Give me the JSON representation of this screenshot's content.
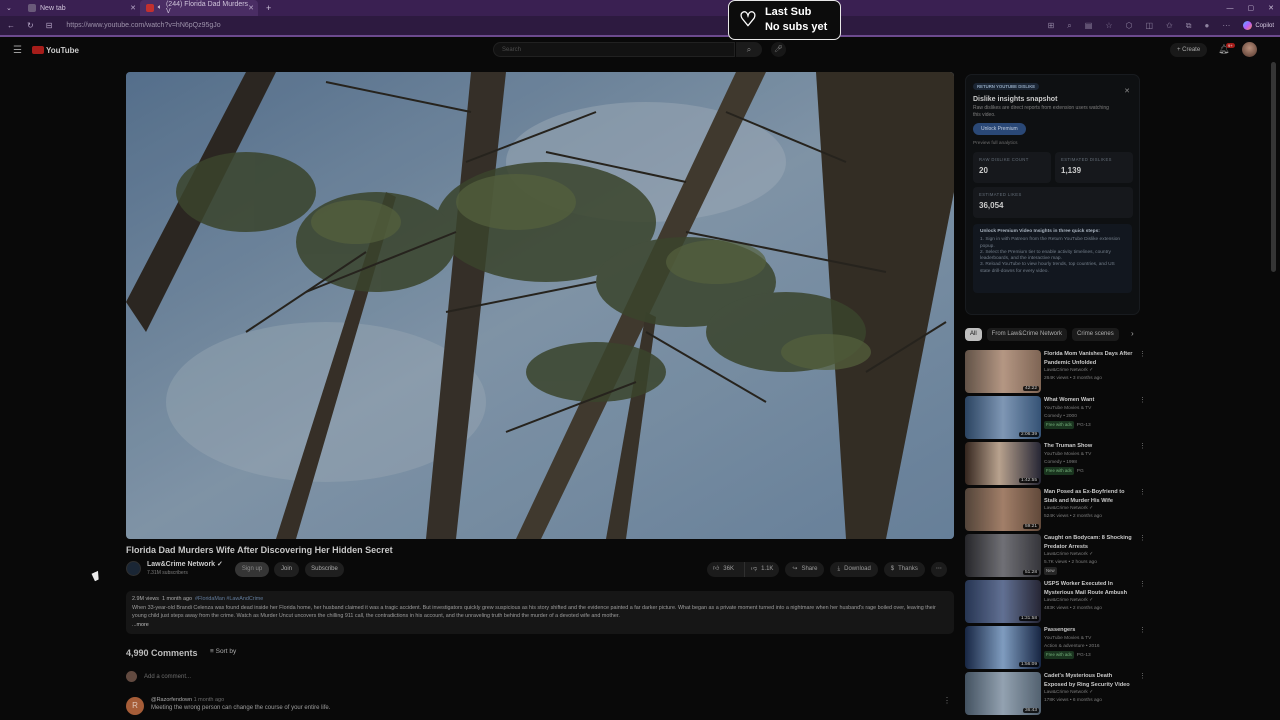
{
  "browser": {
    "tabs": [
      {
        "title": "New tab"
      },
      {
        "title": "(244) Florida Dad Murders V"
      }
    ],
    "url": "https://www.youtube.com/watch?v=hN6pQz95gJo",
    "copilot_label": "Copilot",
    "window_controls": {
      "min": "—",
      "max": "▢",
      "close": "✕"
    }
  },
  "overlay": {
    "last_sub_title": "Last Sub",
    "last_sub_value": "No subs yet"
  },
  "youtube_header": {
    "logo": "YouTube",
    "search_placeholder": "Search",
    "create_label": "Create",
    "notifications_badge": "9+"
  },
  "video": {
    "title": "Florida Dad Murders Wife After Discovering Her Hidden Secret",
    "channel": "Law&Crime Network",
    "subscribers": "7.31M subscribers",
    "signup_label": "Sign up",
    "join_label": "Join",
    "subscribe_label": "Subscribe",
    "likes": "36K",
    "dislikes": "1.1K",
    "share_label": "Share",
    "download_label": "Download",
    "thanks_label": "Thanks"
  },
  "description": {
    "views": "2.9M views",
    "age": "1 month ago",
    "tags": "#FloridaMan #LawAndCrime",
    "body": "When 33-year-old Brandi Celenza was found dead inside her Florida home, her husband claimed it was a tragic accident. But investigators quickly grew suspicious as his story shifted and the evidence painted a far darker picture. What began as a private moment turned into a nightmare when her husband's rage boiled over, leaving their young child just steps away from the crime. Watch as Murder Uncut uncovers the chilling 911 call, the contradictions in his account, and the unraveling truth behind the murder of a devoted wife and mother.",
    "more": "...more"
  },
  "comments": {
    "count": "4,990 Comments",
    "sort_label": "Sort by",
    "add_placeholder": "Add a comment...",
    "items": [
      {
        "initial": "R",
        "author": "@Razorfendown",
        "age": "1 month ago",
        "text": "Meeting the wrong person can change the course of your entire life."
      }
    ]
  },
  "dislike_panel": {
    "badge": "RETURN YOUTUBE DISLIKE",
    "title": "Dislike insights snapshot",
    "subtitle": "Raw dislikes are direct reports from extension users watching this video.",
    "unlock_label": "Unlock Premium",
    "preview_label": "Preview full analytics",
    "stats": [
      {
        "label": "RAW DISLIKE COUNT",
        "value": "20"
      },
      {
        "label": "ESTIMATED DISLIKES",
        "value": "1,139"
      },
      {
        "label": "ESTIMATED LIKES",
        "value": "36,054"
      }
    ],
    "steps_title": "Unlock Premium Video Insights in three quick steps:",
    "steps": [
      "1. Sign in with Patreon from the Return YouTube Dislike extension popup.",
      "2. Select the Premium tier to enable activity timelines, country leaderboards, and the interactive map.",
      "3. Reload YouTube to view hourly trends, top countries, and US state drill-downs for every video."
    ]
  },
  "chips": [
    "All",
    "From Law&Crime Network",
    "Crime scenes"
  ],
  "recommendations": [
    {
      "title": "Florida Mom Vanishes Days After Pandemic Unfolded",
      "channel": "Law&Crime Network",
      "meta": "264K views • 3 months ago",
      "duration": "42:22",
      "tag": ""
    },
    {
      "title": "What Women Want",
      "channel": "YouTube Movies & TV",
      "meta": "Comedy • 2000",
      "duration": "2:06:39",
      "tag": "Free with ads",
      "rating": "PG-13"
    },
    {
      "title": "The Truman Show",
      "channel": "YouTube Movies & TV",
      "meta": "Comedy • 1998",
      "duration": "1:42:55",
      "tag": "Free with ads",
      "rating": "PG"
    },
    {
      "title": "Man Posed as Ex-Boyfriend to Stalk and Murder His Wife",
      "channel": "Law&Crime Network",
      "meta": "524K views • 2 months ago",
      "duration": "59:21",
      "tag": ""
    },
    {
      "title": "Caught on Bodycam: 8 Shocking Predator Arrests",
      "channel": "Law&Crime Network",
      "meta": "5.7K views • 2 hours ago",
      "duration": "51:28",
      "tag": "New"
    },
    {
      "title": "USPS Worker Executed In Mysterious Mail Route Ambush",
      "channel": "Law&Crime Network",
      "meta": "483K views • 2 months ago",
      "duration": "1:31:58",
      "tag": ""
    },
    {
      "title": "Passengers",
      "channel": "YouTube Movies & TV",
      "meta": "Action & adventure • 2016",
      "duration": "1:56:09",
      "tag": "Free with ads",
      "rating": "PG-13"
    },
    {
      "title": "Cadet's Mysterious Death Exposed by Ring Security Video",
      "channel": "Law&Crime Network",
      "meta": "178K views • 6 months ago",
      "duration": "36:43",
      "tag": ""
    }
  ],
  "colors": {
    "browser_frame": "#3a2052",
    "accent_red": "#b5201d",
    "panel_bg": "#101214"
  }
}
